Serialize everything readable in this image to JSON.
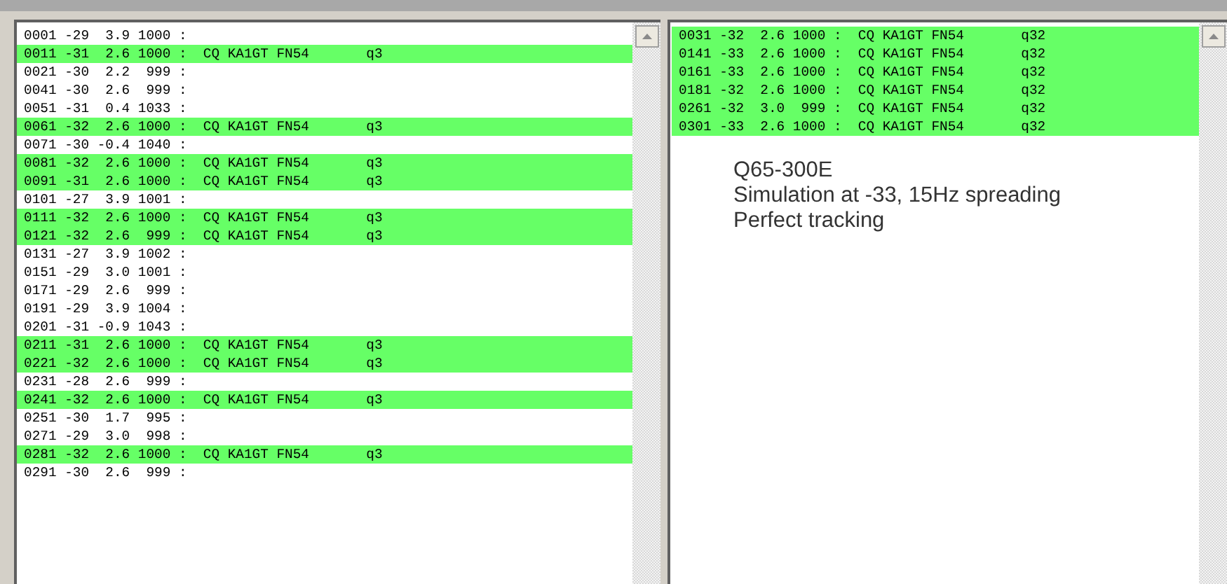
{
  "left_panel": {
    "rows": [
      {
        "text": "0001 -29  3.9 1000 :",
        "highlighted": false
      },
      {
        "text": "0011 -31  2.6 1000 :  CQ KA1GT FN54       q3",
        "highlighted": true
      },
      {
        "text": "0021 -30  2.2  999 :",
        "highlighted": false
      },
      {
        "text": "0041 -30  2.6  999 :",
        "highlighted": false
      },
      {
        "text": "0051 -31  0.4 1033 :",
        "highlighted": false
      },
      {
        "text": "0061 -32  2.6 1000 :  CQ KA1GT FN54       q3",
        "highlighted": true
      },
      {
        "text": "0071 -30 -0.4 1040 :",
        "highlighted": false
      },
      {
        "text": "0081 -32  2.6 1000 :  CQ KA1GT FN54       q3",
        "highlighted": true
      },
      {
        "text": "0091 -31  2.6 1000 :  CQ KA1GT FN54       q3",
        "highlighted": true
      },
      {
        "text": "0101 -27  3.9 1001 :",
        "highlighted": false
      },
      {
        "text": "0111 -32  2.6 1000 :  CQ KA1GT FN54       q3",
        "highlighted": true
      },
      {
        "text": "0121 -32  2.6  999 :  CQ KA1GT FN54       q3",
        "highlighted": true
      },
      {
        "text": "0131 -27  3.9 1002 :",
        "highlighted": false
      },
      {
        "text": "0151 -29  3.0 1001 :",
        "highlighted": false
      },
      {
        "text": "0171 -29  2.6  999 :",
        "highlighted": false
      },
      {
        "text": "0191 -29  3.9 1004 :",
        "highlighted": false
      },
      {
        "text": "0201 -31 -0.9 1043 :",
        "highlighted": false
      },
      {
        "text": "0211 -31  2.6 1000 :  CQ KA1GT FN54       q3",
        "highlighted": true
      },
      {
        "text": "0221 -32  2.6 1000 :  CQ KA1GT FN54       q3",
        "highlighted": true
      },
      {
        "text": "0231 -28  2.6  999 :",
        "highlighted": false
      },
      {
        "text": "0241 -32  2.6 1000 :  CQ KA1GT FN54       q3",
        "highlighted": true
      },
      {
        "text": "0251 -30  1.7  995 :",
        "highlighted": false
      },
      {
        "text": "0271 -29  3.0  998 :",
        "highlighted": false
      },
      {
        "text": "0281 -32  2.6 1000 :  CQ KA1GT FN54       q3",
        "highlighted": true
      },
      {
        "text": "0291 -30  2.6  999 :",
        "highlighted": false
      }
    ]
  },
  "right_panel": {
    "rows": [
      {
        "text": "0031 -32  2.6 1000 :  CQ KA1GT FN54       q32",
        "highlighted": true
      },
      {
        "text": "0141 -33  2.6 1000 :  CQ KA1GT FN54       q32",
        "highlighted": true
      },
      {
        "text": "0161 -33  2.6 1000 :  CQ KA1GT FN54       q32",
        "highlighted": true
      },
      {
        "text": "0181 -32  2.6 1000 :  CQ KA1GT FN54       q32",
        "highlighted": true
      },
      {
        "text": "0261 -32  3.0  999 :  CQ KA1GT FN54       q32",
        "highlighted": true
      },
      {
        "text": "0301 -33  2.6 1000 :  CQ KA1GT FN54       q32",
        "highlighted": true
      }
    ],
    "note": [
      "Q65-300E",
      "Simulation at -33, 15Hz spreading",
      "Perfect tracking"
    ]
  }
}
